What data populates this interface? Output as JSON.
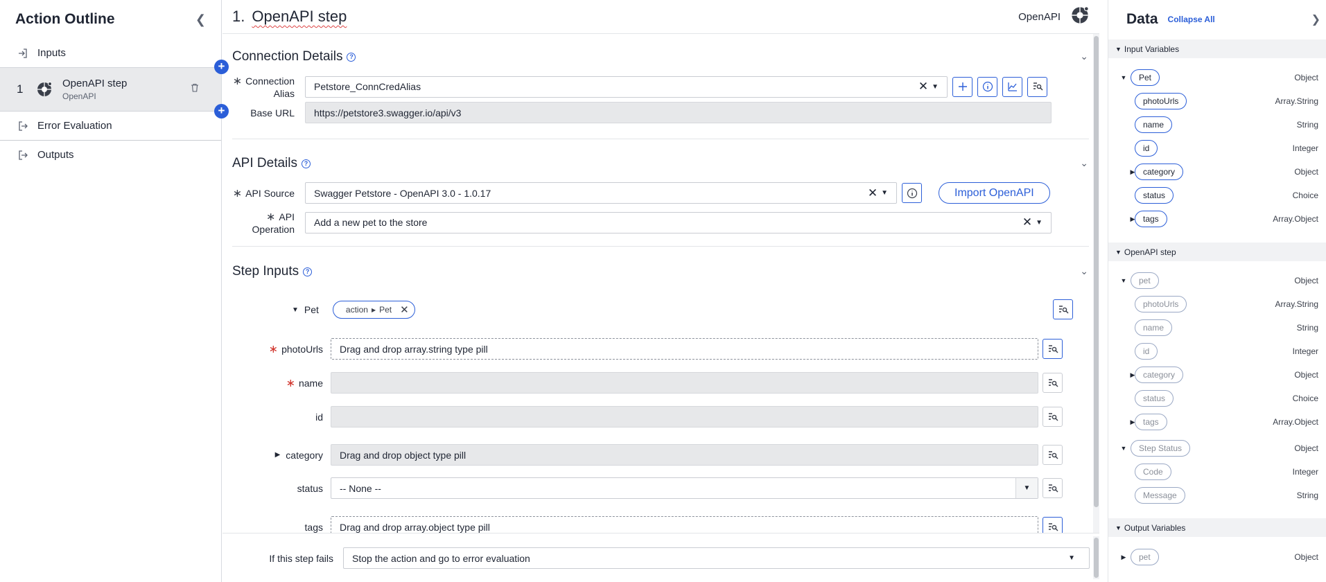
{
  "outline": {
    "title": "Action Outline",
    "items": [
      {
        "label": "Inputs"
      },
      {
        "label": "Error Evaluation"
      },
      {
        "label": "Outputs"
      }
    ],
    "step": {
      "number": "1",
      "name": "OpenAPI step",
      "type": "OpenAPI"
    }
  },
  "editor": {
    "step_number": "1.",
    "step_title": "OpenAPI step",
    "step_type": "OpenAPI",
    "connection": {
      "title": "Connection Details",
      "alias_label": "Connection Alias",
      "alias_value": "Petstore_ConnCredAlias",
      "base_url_label": "Base URL",
      "base_url_value": "https://petstore3.swagger.io/api/v3"
    },
    "api": {
      "title": "API Details",
      "source_label": "API Source",
      "source_value": "Swagger Petstore - OpenAPI 3.0 - 1.0.17",
      "import_label": "Import OpenAPI",
      "operation_label": "API Operation",
      "operation_value": "Add a new pet to the store"
    },
    "inputs": {
      "title": "Step Inputs",
      "pet_label": "Pet",
      "pet_pill_root": "action",
      "pet_pill_leaf": "Pet",
      "photoUrls_label": "photoUrls",
      "photoUrls_placeholder": "Drag and drop array.string type pill",
      "name_label": "name",
      "id_label": "id",
      "category_label": "category",
      "category_placeholder": "Drag and drop object type pill",
      "status_label": "status",
      "status_value": "-- None --",
      "tags_label": "tags",
      "tags_placeholder": "Drag and drop array.object type pill"
    },
    "footer": {
      "fail_label": "If this step fails",
      "fail_value": "Stop the action and go to error evaluation"
    }
  },
  "data_panel": {
    "title": "Data",
    "collapse_all": "Collapse All",
    "groups": [
      {
        "label": "Input Variables",
        "rows": [
          {
            "name": "Pet",
            "type": "Object"
          },
          {
            "name": "photoUrls",
            "type": "Array.String"
          },
          {
            "name": "name",
            "type": "String"
          },
          {
            "name": "id",
            "type": "Integer"
          },
          {
            "name": "category",
            "type": "Object"
          },
          {
            "name": "status",
            "type": "Choice"
          },
          {
            "name": "tags",
            "type": "Array.Object"
          }
        ]
      },
      {
        "label": "OpenAPI step",
        "rows": [
          {
            "name": "pet",
            "type": "Object"
          },
          {
            "name": "photoUrls",
            "type": "Array.String"
          },
          {
            "name": "name",
            "type": "String"
          },
          {
            "name": "id",
            "type": "Integer"
          },
          {
            "name": "category",
            "type": "Object"
          },
          {
            "name": "status",
            "type": "Choice"
          },
          {
            "name": "tags",
            "type": "Array.Object"
          },
          {
            "name": "Step Status",
            "type": "Object"
          },
          {
            "name": "Code",
            "type": "Integer"
          },
          {
            "name": "Message",
            "type": "String"
          }
        ]
      },
      {
        "label": "Output Variables",
        "rows": [
          {
            "name": "pet",
            "type": "Object"
          }
        ]
      }
    ]
  },
  "colors": {
    "accent": "#2b5ed8",
    "required": "#d0342c",
    "readonly_bg": "#e7e8ea"
  }
}
